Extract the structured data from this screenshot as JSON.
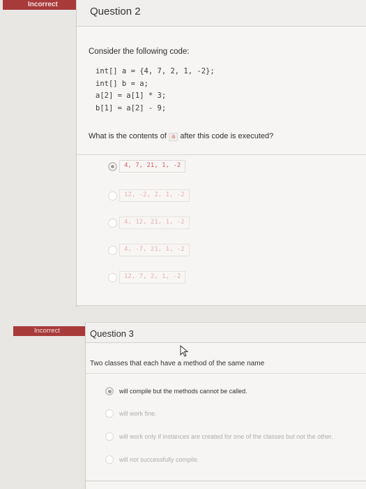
{
  "question2": {
    "status_badge": "Incorrect",
    "title": "Question 2",
    "intro": "Consider the following code:",
    "code_lines": [
      "int[] a = {4, 7, 2, 1, -2};",
      "int[] b = a;",
      "a[2] = a[1] * 3;",
      "b[1] = a[2] - 9;"
    ],
    "prompt_before": "What is the contents of",
    "prompt_code": "a",
    "prompt_after": "after this code is executed?",
    "options": [
      {
        "text": "4, 7, 21, 1, -2",
        "selected": true
      },
      {
        "text": "12, -2, 2, 1, -2",
        "selected": false
      },
      {
        "text": "4, 12, 21, 1, -2",
        "selected": false
      },
      {
        "text": "4, -7, 21, 1, -2",
        "selected": false
      },
      {
        "text": "12, 7, 2, 1, -2",
        "selected": false
      }
    ]
  },
  "question3": {
    "status_badge": "Incorrect",
    "title": "Question 3",
    "prompt": "Two classes that each have a method of the same name",
    "options": [
      {
        "text": "will compile but the methods cannot be called.",
        "selected": true
      },
      {
        "text": "will work fine.",
        "selected": false
      },
      {
        "text": "will work only if instances are created for one of the classes but not the other.",
        "selected": false
      },
      {
        "text": "will not successfully compile.",
        "selected": false
      }
    ]
  },
  "colors": {
    "badge": "#a83a3a",
    "code_accent": "#d06060"
  }
}
